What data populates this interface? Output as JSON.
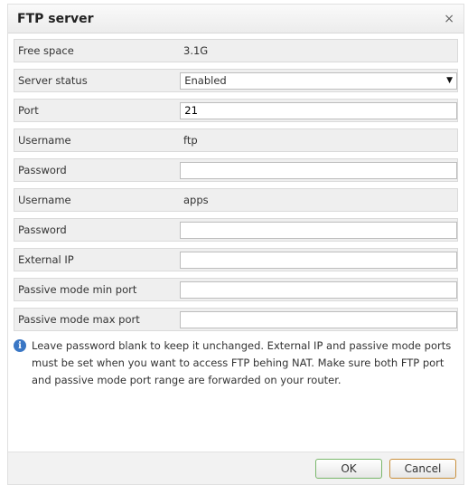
{
  "dialog": {
    "title": "FTP server",
    "close_glyph": "×"
  },
  "fields": {
    "free_space": {
      "label": "Free space",
      "value": "3.1G"
    },
    "server_status": {
      "label": "Server status",
      "value": "Enabled"
    },
    "port": {
      "label": "Port",
      "value": "21"
    },
    "username1": {
      "label": "Username",
      "value": "ftp"
    },
    "password1": {
      "label": "Password",
      "value": ""
    },
    "username2": {
      "label": "Username",
      "value": "apps"
    },
    "password2": {
      "label": "Password",
      "value": ""
    },
    "external_ip": {
      "label": "External IP",
      "value": ""
    },
    "passive_min": {
      "label": "Passive mode min port",
      "value": ""
    },
    "passive_max": {
      "label": "Passive mode max port",
      "value": ""
    }
  },
  "note": {
    "icon": "info-icon",
    "icon_glyph": "i",
    "text": "Leave password blank to keep it unchanged. External IP and passive mode ports must be set when you want to access FTP behing NAT. Make sure both FTP port and passive mode port range are forwarded on your router."
  },
  "buttons": {
    "ok": "OK",
    "cancel": "Cancel"
  },
  "colors": {
    "info_icon": "#3a77c5",
    "ok_border": "#7ab86b",
    "cancel_border": "#c9903d"
  }
}
